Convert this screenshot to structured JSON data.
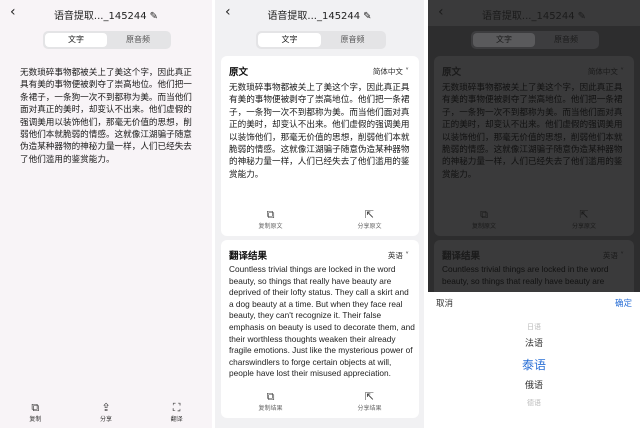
{
  "header": {
    "title": "语音提取..._145244",
    "back_icon": "‹",
    "edit_icon": "✎"
  },
  "tabs": {
    "text": "文字",
    "audio": "原音频"
  },
  "original": {
    "heading": "原文",
    "language": "简体中文 ˅",
    "text": "无数琐碎事物都被关上了美这个字，因此真正具有美的事物便被剥夺了崇高地位。他们把一条裙子，一条狗一次不到都称为美。而当他们面对真正的美时，却变认不出来。他们虚假的强调美用以装饰他们，那毫无价值的思想，削弱他们本就脆弱的情感。这就像江湖骗子随意伪造某种器物的神秘力量一样，人们已经失去了他们滥用的鉴赏能力。",
    "copy": "复制原文",
    "share": "分享原文"
  },
  "translation": {
    "heading": "翻译结果",
    "language": "英语 ˅",
    "text": "Countless trivial things are locked in the word beauty, so things that really have beauty are deprived of their lofty status. They call a skirt and a dog beauty at a time. But when they face real beauty, they can't recognize it. Their false emphasis on beauty is used to decorate them, and their worthless thoughts weaken their already fragile emotions. Just like the mysterious power of charswindlers to forge certain objects at will, people have lost their misused appreciation.",
    "copy": "复制结果",
    "share": "分享结果"
  },
  "bottom_bar": {
    "copy": "复制",
    "share": "分享",
    "translate": "翻译"
  },
  "picker": {
    "cancel": "取消",
    "confirm": "确定",
    "items": [
      "日语",
      "法语",
      "泰语",
      "俄语",
      "德语"
    ],
    "selected": "泰语"
  },
  "colors": {
    "accent": "#2a6fd6",
    "background": "#f8f4f7"
  }
}
